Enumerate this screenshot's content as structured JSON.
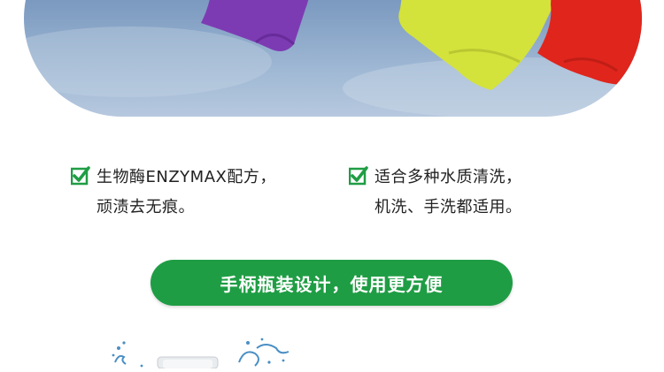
{
  "hero": {
    "image": "laundry-on-line-photo",
    "sky_color": "#7f9dc2",
    "cloth_colors": [
      "#7d3bb3",
      "#d4e23c",
      "#e0251c"
    ]
  },
  "features": [
    {
      "icon": "check-icon",
      "line1": "生物酶ENZYMAX配方，",
      "line2": "顽渍去无痕。"
    },
    {
      "icon": "check-icon",
      "line1": "适合多种水质清洗，",
      "line2": "机洗、手洗都适用。"
    }
  ],
  "banner": {
    "label": "手柄瓶装设计，使用更方便",
    "color": "#1f9d44"
  },
  "product_peek": {
    "image": "detergent-bottle-splash"
  },
  "colors": {
    "accent": "#1f9d44",
    "text": "#222222"
  }
}
